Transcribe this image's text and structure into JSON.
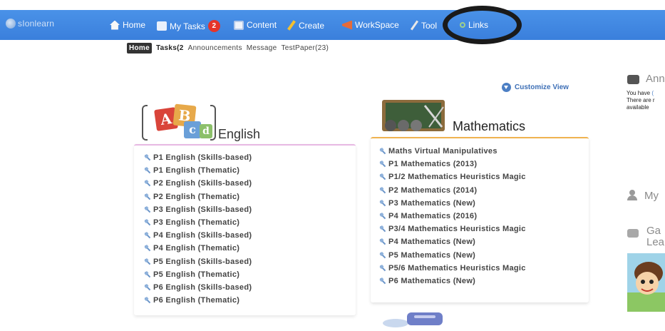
{
  "app": {
    "logo_text": "sIonlearn"
  },
  "nav": {
    "home": "Home",
    "my_tasks": "My Tasks",
    "my_tasks_badge": "2",
    "content": "Content",
    "create": "Create",
    "workspace": "WorkSpace",
    "tool": "Tool",
    "links": "Links"
  },
  "subtabs": {
    "home": "Home",
    "tasks": "Tasks(2",
    "announcements": "Announcements",
    "message": "Message",
    "testpaper": "TestPaper(23)"
  },
  "customize_view": "Customize View",
  "english": {
    "title": "English",
    "icon_letters": [
      "A",
      "B",
      "c",
      "d"
    ],
    "items": [
      "P1 English (Skills-based)",
      "P1 English (Thematic)",
      "P2 English (Skills-based)",
      "P2 English (Thematic)",
      "P3 English (Skills-based)",
      "P3 English (Thematic)",
      "P4 English (Skills-based)",
      "P4 English (Thematic)",
      "P5 English (Skills-based)",
      "P5 English (Thematic)",
      "P6 English (Skills-based)",
      "P6 English (Thematic)"
    ]
  },
  "mathematics": {
    "title": "Mathematics",
    "items": [
      "Maths Virtual Manipulatives",
      "P1 Mathematics (2013)",
      "P1/2 Mathematics Heuristics Magic",
      "P2 Mathematics (2014)",
      "P3 Mathematics (New)",
      "P4 Mathematics (2016)",
      "P3/4 Mathematics Heuristics Magic",
      "P4 Mathematics (New)",
      "P5 Mathematics (New)",
      "P5/6 Mathematics Heuristics Magic",
      "P6 Mathematics (New)"
    ]
  },
  "right_column": {
    "announcements_heading": "Ann",
    "announcements_line1": "You have",
    "announcements_line1_link": "(",
    "announcements_line2": "There are r",
    "announcements_line3": "available",
    "my_heading": "My",
    "games_heading_line1": "Ga",
    "games_heading_line2": "Lea"
  },
  "colors": {
    "nav_blue": "#3a7fdc",
    "badge_red": "#e5342a",
    "english_border": "#e7b8e3",
    "math_border": "#f0b24f",
    "link_blue": "#3d6fb6"
  },
  "icons": {
    "nav": [
      "home-icon",
      "tasks-icon",
      "content-icon",
      "pencil-icon",
      "workspace-icon",
      "tool-icon",
      "link-icon"
    ],
    "list_item": "wrench-icon",
    "customize": "chevron-down-icon",
    "right": [
      "chat-icon",
      "user-icon",
      "game-icon"
    ]
  }
}
